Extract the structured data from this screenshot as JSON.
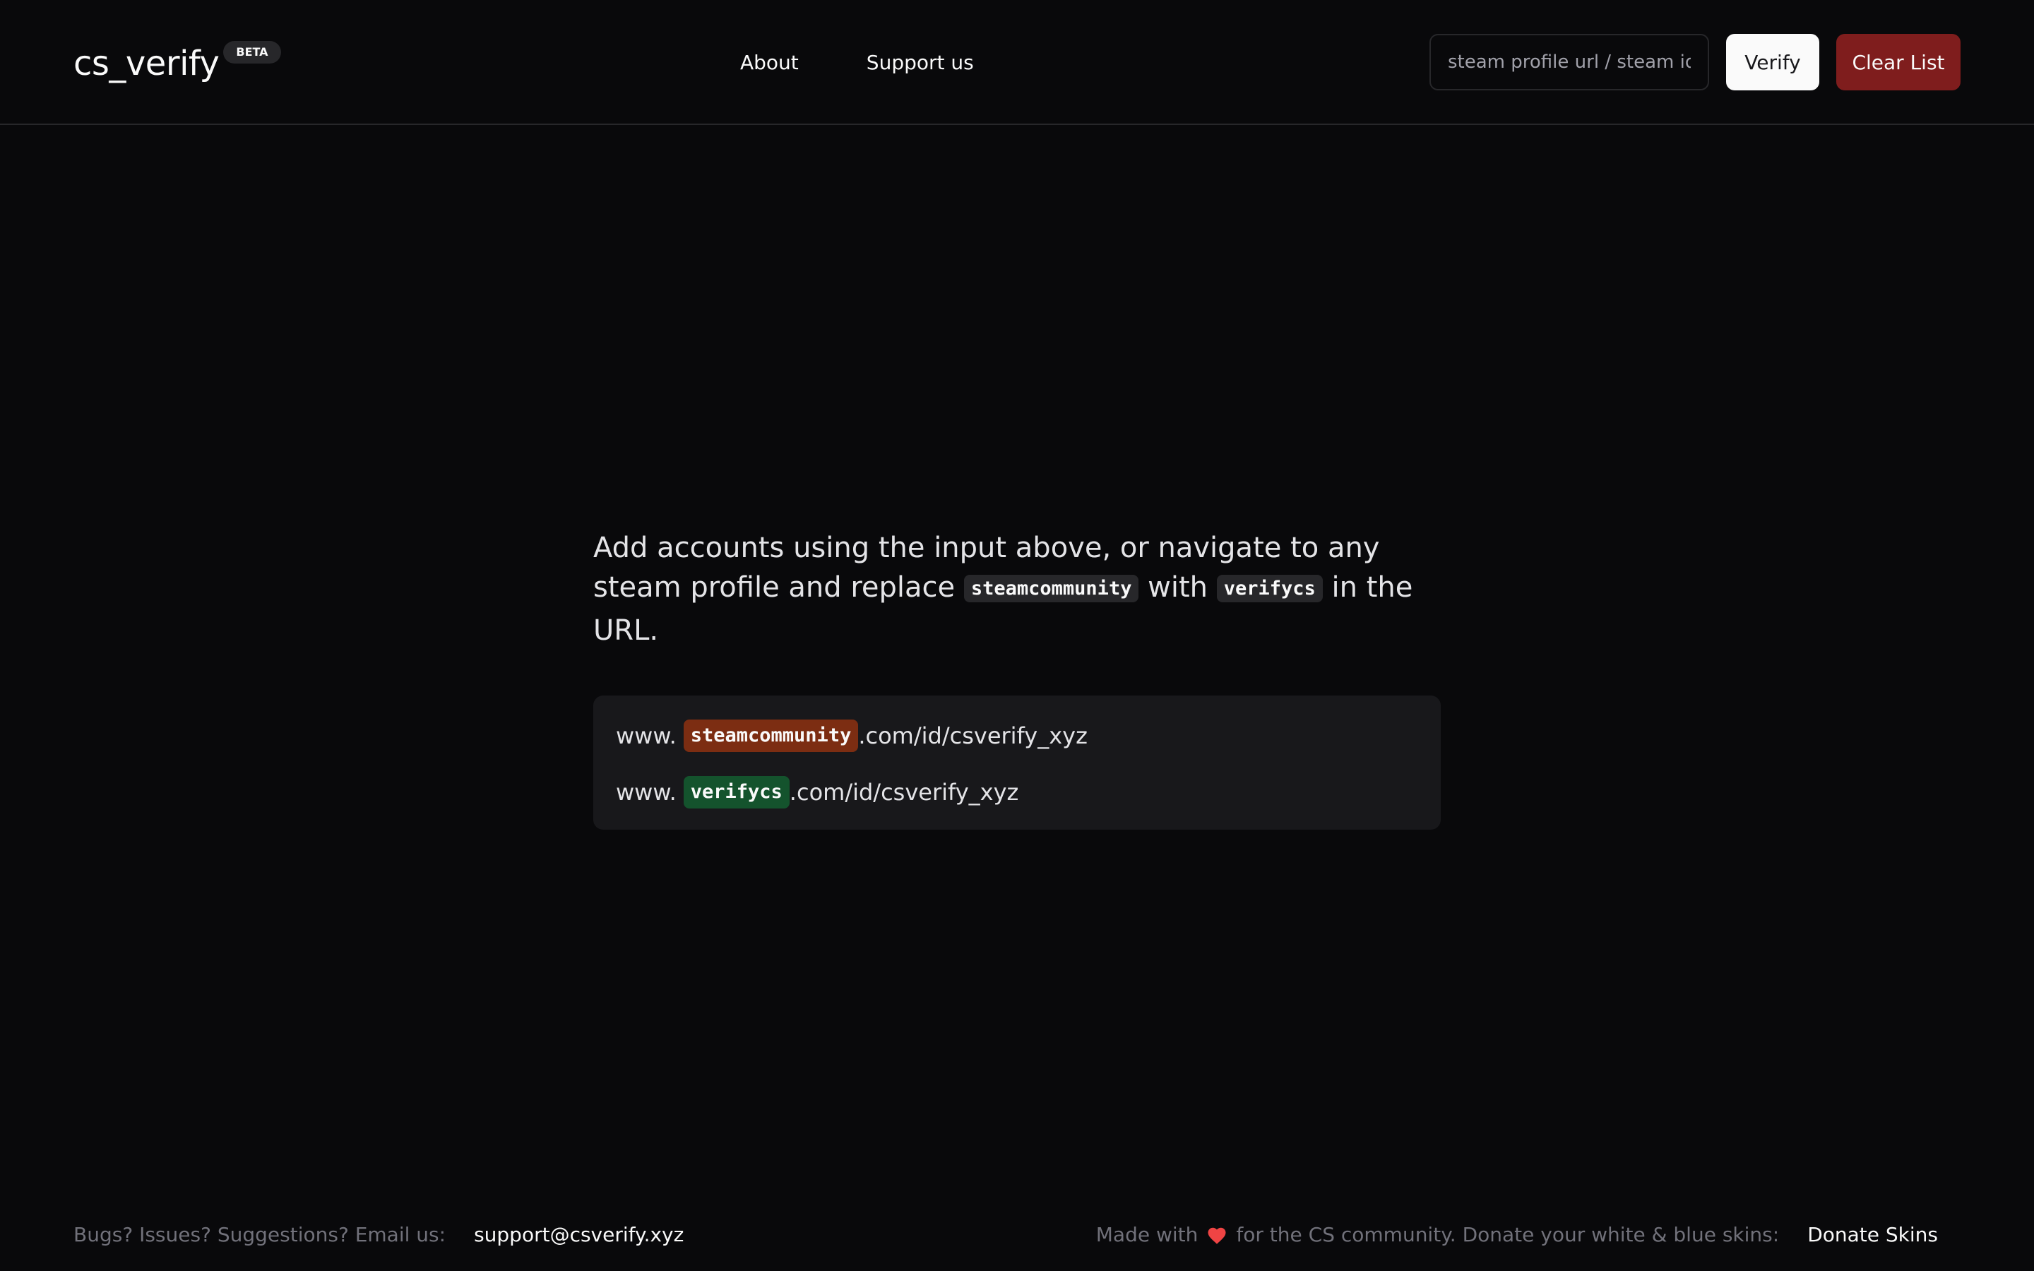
{
  "header": {
    "brand": "cs_verify",
    "badge": "BETA",
    "nav": {
      "about": "About",
      "support": "Support us"
    },
    "search": {
      "placeholder": "steam profile url / steam id",
      "value": ""
    },
    "verify_label": "Verify",
    "clear_label": "Clear List"
  },
  "main": {
    "instructions": {
      "part1": "Add accounts using the input above, or navigate to any steam profile and replace",
      "chip_old": "steamcommunity",
      "part2": "with",
      "chip_new": "verifycs",
      "part3": "in the URL."
    },
    "example": {
      "prefix": "www.",
      "old_domain": "steamcommunity",
      "new_domain": "verifycs",
      "path": ".com/id/csverify_xyz"
    }
  },
  "footer": {
    "bugs_text": "Bugs? Issues? Suggestions? Email us:",
    "email": "support@csverify.xyz",
    "made_with": "Made with",
    "community_text": "for the CS community. Donate your white & blue skins:",
    "donate_label": "Donate Skins"
  },
  "colors": {
    "background": "#09090b",
    "danger": "#7f1d1d",
    "old_chip": "#7c2d12",
    "new_chip": "#14532d",
    "heart": "#ef4444"
  },
  "icons": {
    "heart": "heart-icon"
  }
}
